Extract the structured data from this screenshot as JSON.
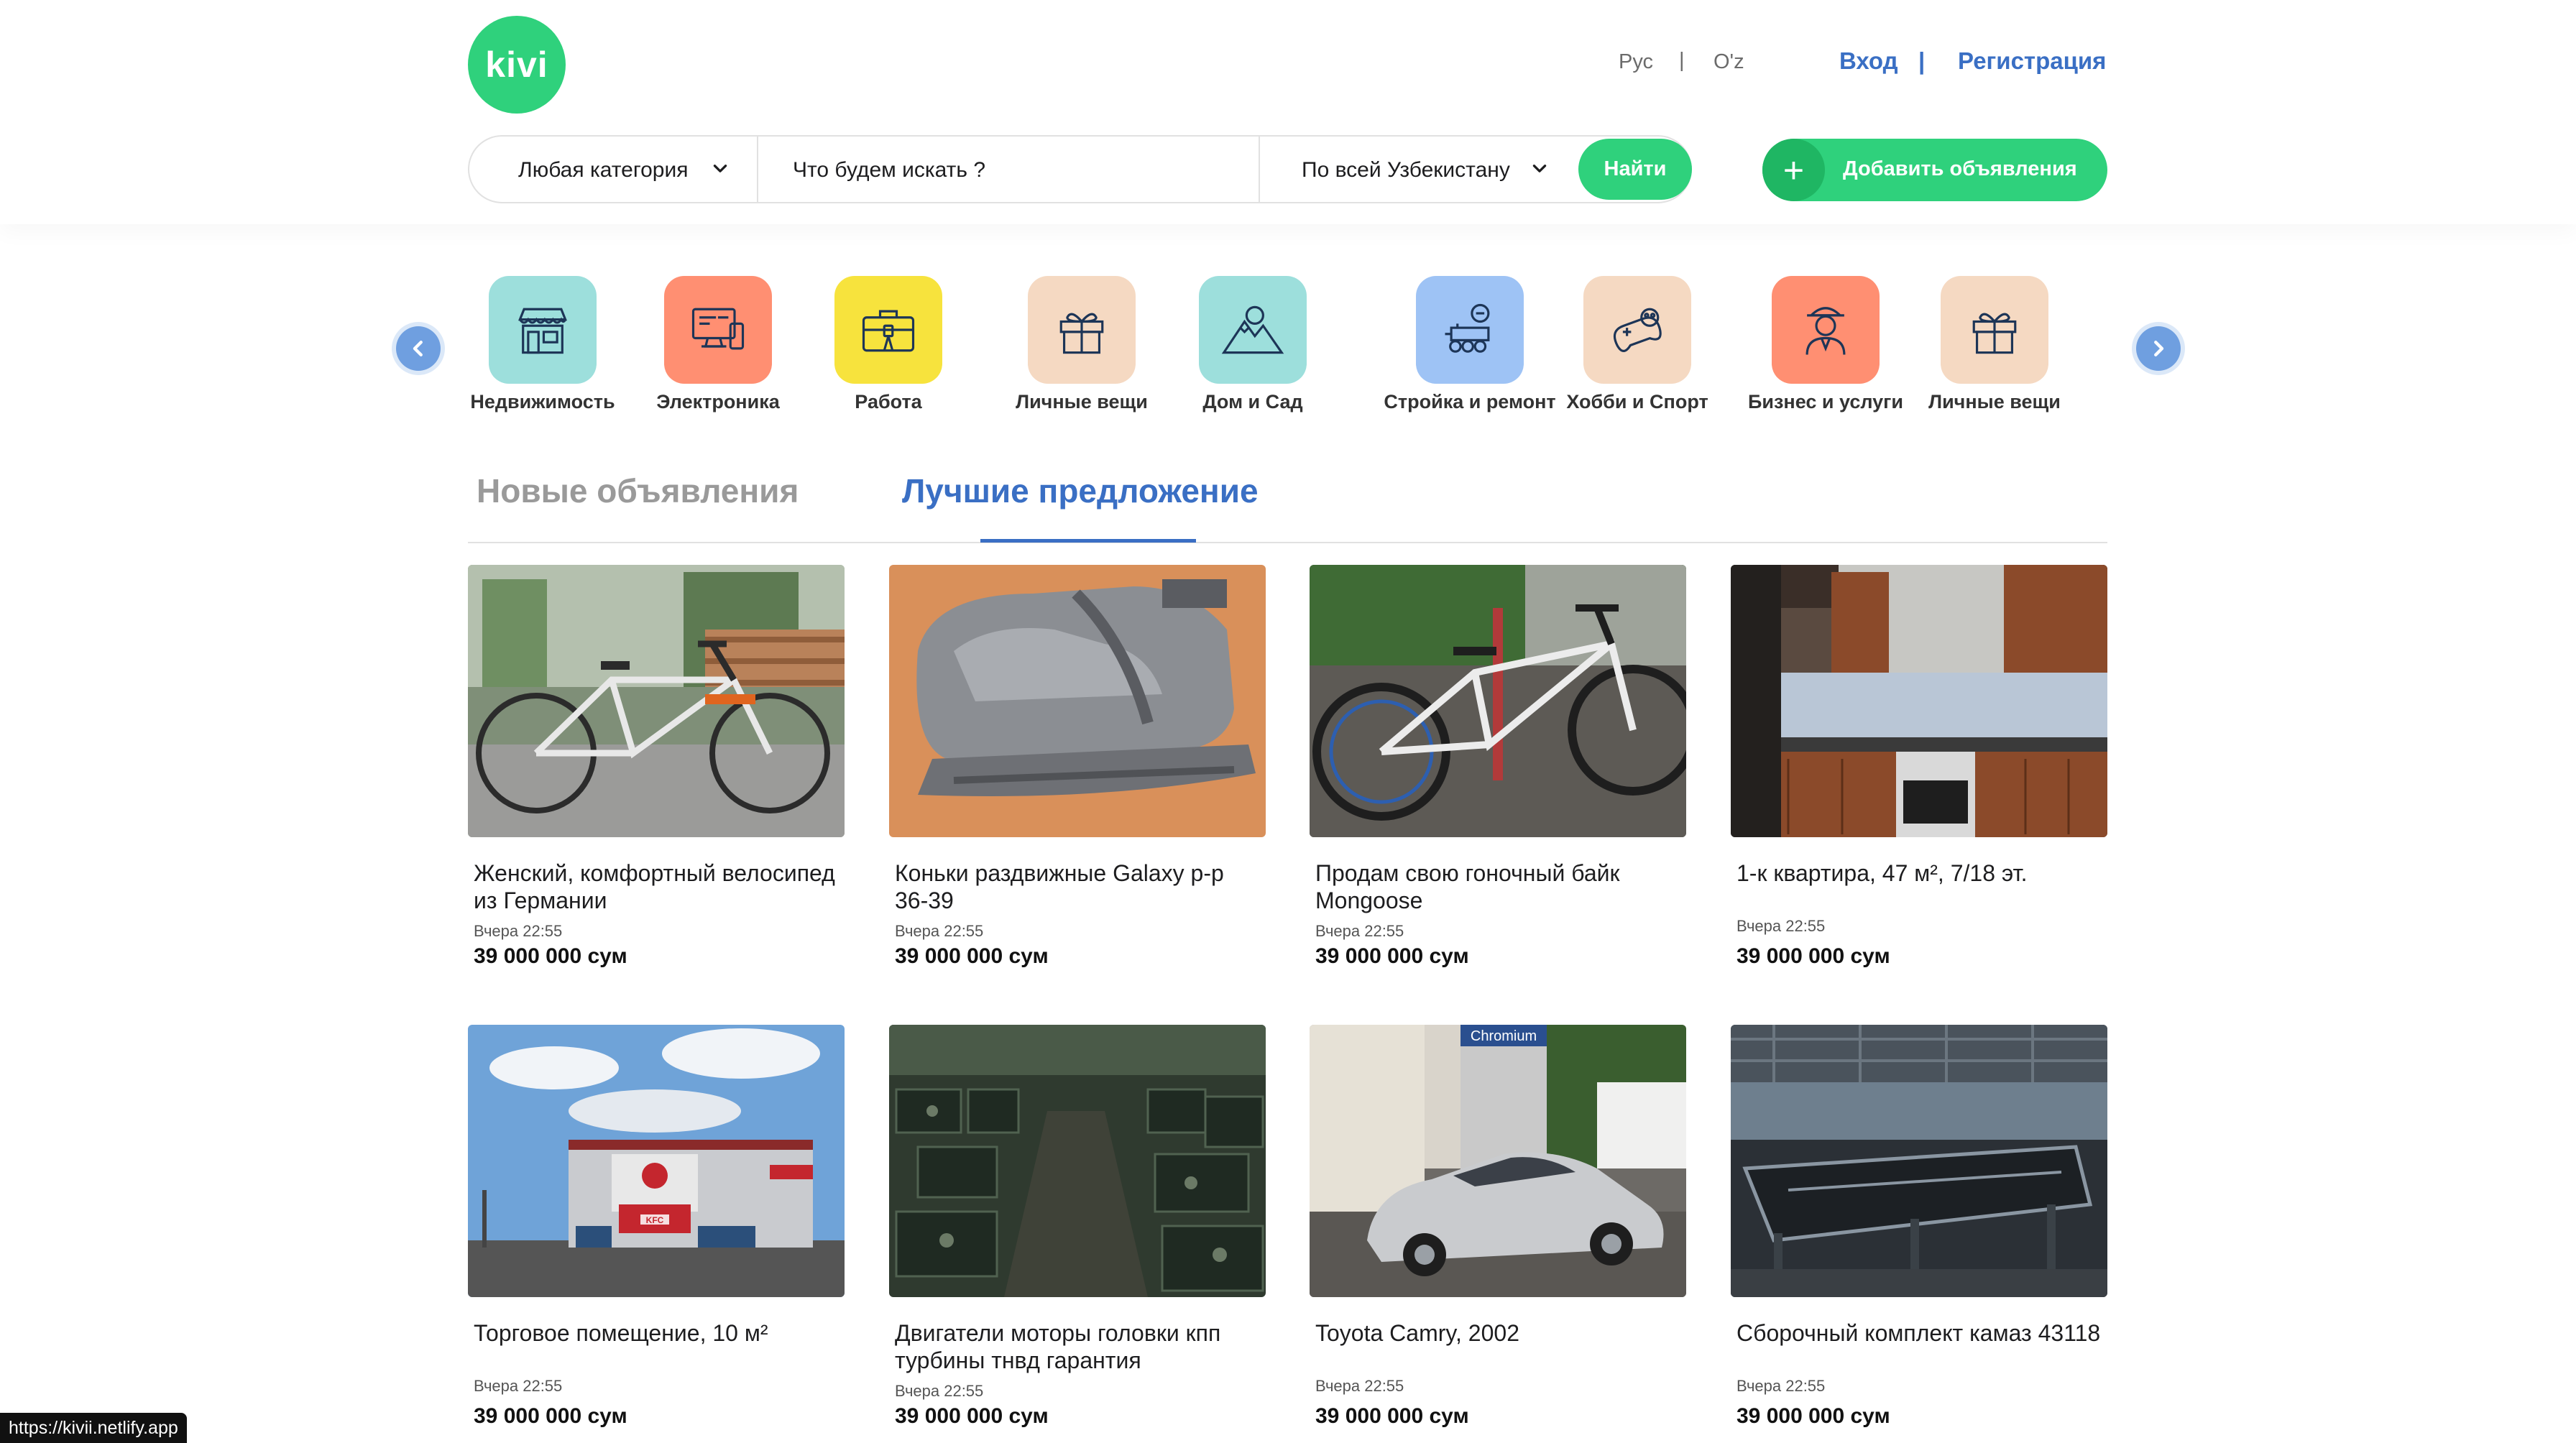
{
  "header": {
    "logo_text": "kivi",
    "lang_ru": "Рус",
    "lang_uz": "O'z",
    "separator": "|",
    "login": "Вход",
    "register": "Регистрация",
    "category_select": "Любая категория",
    "search_placeholder": "Что будем искать ?",
    "region_select": "По всей Узбекистану",
    "find_button": "Найти",
    "add_button": "Добавить объявления",
    "add_icon": "+"
  },
  "categories": [
    {
      "label": "Недвижимость",
      "icon": "shop-icon",
      "color": "#9ddfdc"
    },
    {
      "label": "Электроника",
      "icon": "computer-icon",
      "color": "#ff8f72"
    },
    {
      "label": "Работа",
      "icon": "briefcase-icon",
      "color": "#f7e33d"
    },
    {
      "label": "Личные вещи",
      "icon": "gift-icon",
      "color": "#f5d9c2"
    },
    {
      "label": "Дом и Сад",
      "icon": "mountain-icon",
      "color": "#9ddfdc"
    },
    {
      "label": "Стройка и ремонт",
      "icon": "construction-icon",
      "color": "#9ec3f5"
    },
    {
      "label": "Хобби и Спорт",
      "icon": "gamepad-icon",
      "color": "#f5d9c2"
    },
    {
      "label": "Бизнес и услуги",
      "icon": "businessman-icon",
      "color": "#ff8f72"
    },
    {
      "label": "Личные вещи",
      "icon": "gift-icon",
      "color": "#f5d9c2"
    }
  ],
  "tabs": {
    "new": "Новые объявления",
    "best": "Лучшие предложение",
    "active": "best"
  },
  "listings": [
    {
      "title": "Женский, комфортный велосипед из Германии",
      "date": "Вчера 22:55",
      "price": "39 000 000 сум"
    },
    {
      "title": "Коньки раздвижные Galaxy р-р 36-39",
      "date": "Вчера 22:55",
      "price": "39 000 000 сум"
    },
    {
      "title": "Продам свою гоночный байк Mongoose",
      "date": "Вчера 22:55",
      "price": "39 000 000 сум"
    },
    {
      "title": "1-к квартира, 47 м², 7/18 эт.",
      "date": "Вчера 22:55",
      "price": "39 000 000 сум"
    },
    {
      "title": "Торговое помещение, 10 м²",
      "date": "Вчера 22:55",
      "price": "39 000 000 сум"
    },
    {
      "title": "Двигатели моторы головки кпп турбины тнвд гарантия",
      "date": "Вчера 22:55",
      "price": "39 000 000 сум"
    },
    {
      "title": "Toyota Camry, 2002",
      "date": "Вчера 22:55",
      "price": "39 000 000 сум"
    },
    {
      "title": "Сборочный комплект камаз 43118",
      "date": "Вчера 22:55",
      "price": "39 000 000 сум"
    }
  ],
  "photo_signs": {
    "kfc": "KFC",
    "chromium": "Chromium"
  },
  "status_url": "https://kivii.netlify.app",
  "colors": {
    "brand_green": "#2fd17c",
    "link_blue": "#3a6fc4",
    "arrow_blue": "#6f9fe0"
  }
}
